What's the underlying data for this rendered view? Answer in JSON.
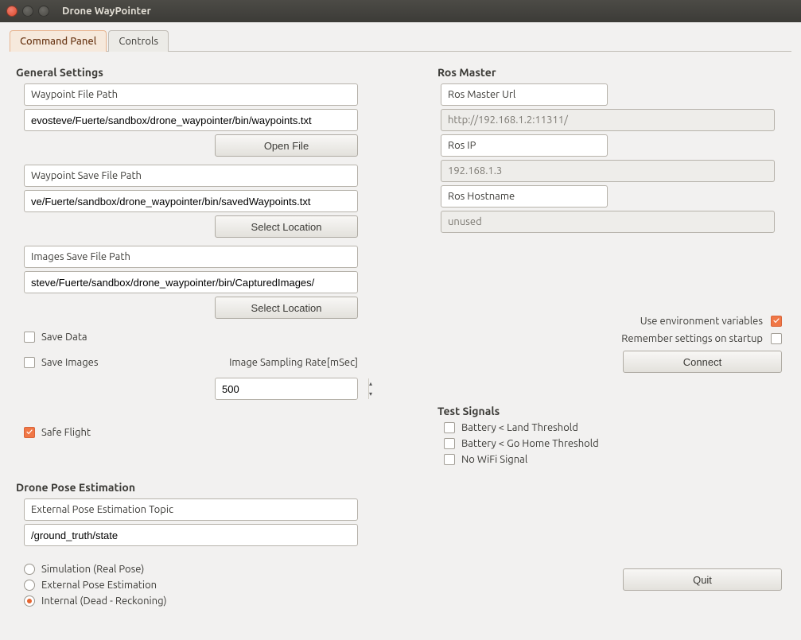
{
  "window": {
    "title": "Drone WayPointer"
  },
  "tabs": {
    "command_panel": "Command Panel",
    "controls": "Controls"
  },
  "general": {
    "title": "General Settings",
    "wp_file_label": "Waypoint File Path",
    "wp_file_value": "evosteve/Fuerte/sandbox/drone_waypointer/bin/waypoints.txt",
    "open_file": "Open File",
    "wp_save_label": "Waypoint Save File Path",
    "wp_save_value": "ve/Fuerte/sandbox/drone_waypointer/bin/savedWaypoints.txt",
    "select_location": "Select Location",
    "img_save_label": "Images Save File Path",
    "img_save_value": "steve/Fuerte/sandbox/drone_waypointer/bin/CapturedImages/",
    "save_data": "Save Data",
    "save_images": "Save Images",
    "sampling_label": "Image Sampling Rate[mSec]",
    "sampling_value": "500",
    "safe_flight": "Safe Flight"
  },
  "pose": {
    "title": "Drone Pose Estimation",
    "ext_topic_label": "External Pose Estimation Topic",
    "ext_topic_value": "/ground_truth/state",
    "opt_sim": "Simulation (Real Pose)",
    "opt_ext": "External Pose Estimation",
    "opt_int": "Internal (Dead - Reckoning)"
  },
  "ros": {
    "title": "Ros Master",
    "url_label": "Ros Master Url",
    "url_value": "http://192.168.1.2:11311/",
    "ip_label": "Ros IP",
    "ip_value": "192.168.1.3",
    "host_label": "Ros Hostname",
    "host_value": "unused",
    "use_env": "Use environment variables",
    "remember": "Remember settings on startup",
    "connect": "Connect"
  },
  "test": {
    "title": "Test Signals",
    "land": "Battery < Land Threshold",
    "gohome": "Battery < Go Home Threshold",
    "wifi": "No WiFi Signal"
  },
  "quit": "Quit"
}
